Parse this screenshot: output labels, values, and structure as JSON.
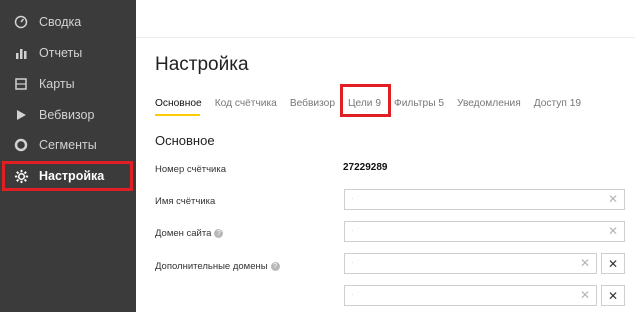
{
  "sidebar": {
    "items": [
      {
        "label": "Сводка",
        "icon": "dashboard-icon"
      },
      {
        "label": "Отчеты",
        "icon": "bar-chart-icon"
      },
      {
        "label": "Карты",
        "icon": "map-icon"
      },
      {
        "label": "Вебвизор",
        "icon": "play-icon"
      },
      {
        "label": "Сегменты",
        "icon": "segments-icon"
      },
      {
        "label": "Настройка",
        "icon": "gear-icon"
      }
    ],
    "active_index": 5
  },
  "main": {
    "title": "Настройка",
    "tabs": [
      {
        "label": "Основное"
      },
      {
        "label": "Код счётчика"
      },
      {
        "label": "Вебвизор"
      },
      {
        "label": "Цели 9"
      },
      {
        "label": "Фильтры 5"
      },
      {
        "label": "Уведомления"
      },
      {
        "label": "Доступ 19"
      }
    ],
    "active_tab": 0,
    "section_title": "Основное",
    "fields": {
      "counter_number": {
        "label": "Номер счётчика",
        "value": "27229289"
      },
      "counter_name": {
        "label": "Имя счётчика",
        "value": "·"
      },
      "site_domain": {
        "label": "Домен сайта",
        "value": "·"
      },
      "extra_domains": {
        "label": "Дополнительные домены",
        "values": [
          "·",
          "·"
        ]
      }
    },
    "remove_symbol": "✕",
    "clear_symbol": "✕"
  },
  "colors": {
    "sidebar_bg": "#3b3b3b",
    "highlight": "#e01e23",
    "tab_underline": "#ffcc00"
  }
}
